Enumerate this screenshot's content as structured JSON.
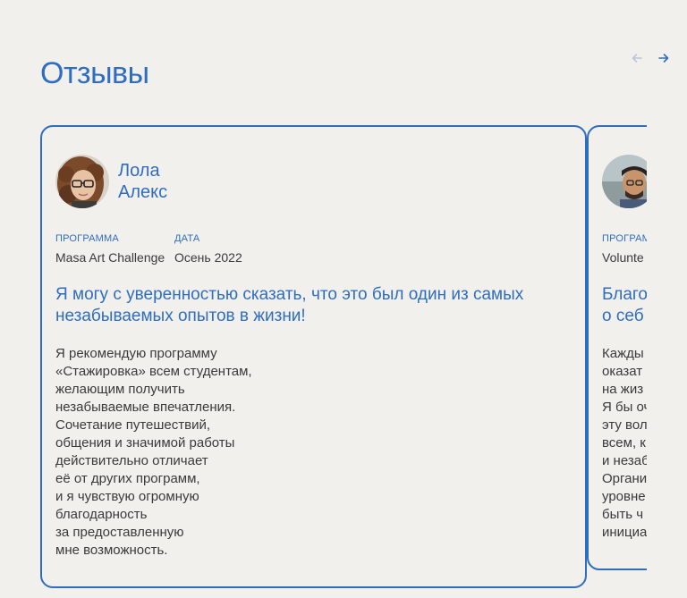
{
  "section": {
    "title": "Отзывы"
  },
  "navigation": {
    "prev_icon": "arrow-left-icon",
    "next_icon": "arrow-right-icon",
    "prev_color": "#b9c6dc",
    "next_color": "#2f6dc0"
  },
  "colors": {
    "accent": "#2f6dc0",
    "background": "#f1f0ec",
    "text": "#3a3a3a"
  },
  "reviews": [
    {
      "name_line1": "Лола",
      "name_line2": "Алекс",
      "program_label": "ПРОГРАММА",
      "program": "Masa Art Challenge",
      "date_label": "ДАТА",
      "date": "Осень 2022",
      "quote": "Я могу с уверенностью сказать, что это был один из самых незабываемых опытов в жизни!",
      "body": "Я рекомендую программу\n«Стажировка» всем студентам,\nжелающим получить\nнезабываемые впечатления.\nСочетание путешествий,\nобщения и значимой работы\nдействительно отличает\neё от других программ,\nи я чувствую огромную\nблагодарность\nза предоставленную\nмне возможность."
    },
    {
      "program_label": "ПРОГРАМ",
      "program": "Volunte",
      "quote": "Благо\nо себ",
      "body": "Кажды\nоказат\nна жиз\nЯ бы оч\nэту вол\nвсем, к\nи незаб\nОргани\nуровне\nбыть ч\nинициа"
    }
  ]
}
